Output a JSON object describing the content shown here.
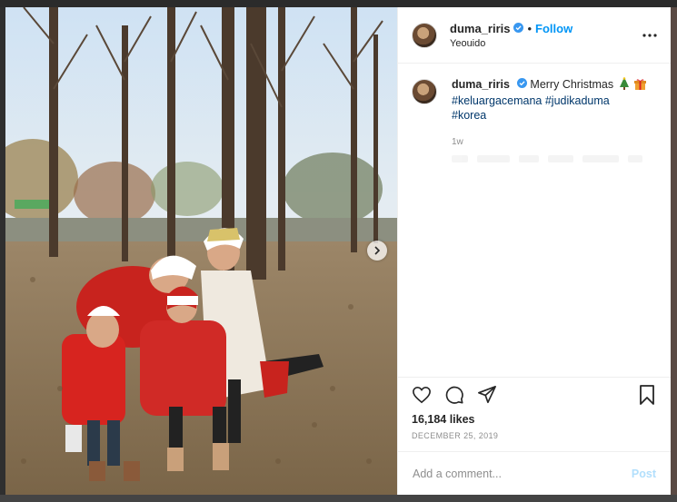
{
  "post": {
    "username": "duma_riris",
    "follow_label": "Follow",
    "location": "Yeouido",
    "separator": "•",
    "caption_text": "Merry Christmas",
    "hashtags": [
      "#keluargacemana",
      "#judikaduma",
      "#korea"
    ],
    "time_ago": "1w",
    "likes": "16,184 likes",
    "date": "DECEMBER 25, 2019"
  },
  "comment_box": {
    "placeholder": "Add a comment...",
    "post_label": "Post"
  },
  "icons": {
    "header": [
      "verified-badge-icon",
      "more-options-icon"
    ],
    "caption": [
      "christmas-tree-emoji",
      "gift-emoji"
    ],
    "actions": [
      "heart-icon",
      "comment-icon",
      "share-icon",
      "bookmark-icon"
    ],
    "photo": [
      "next-arrow-icon"
    ]
  },
  "colors": {
    "accent": "#0095f6",
    "hashtag": "#00376b",
    "secondary_text": "#8e8e8e",
    "post_disabled": "#b2dffc"
  }
}
